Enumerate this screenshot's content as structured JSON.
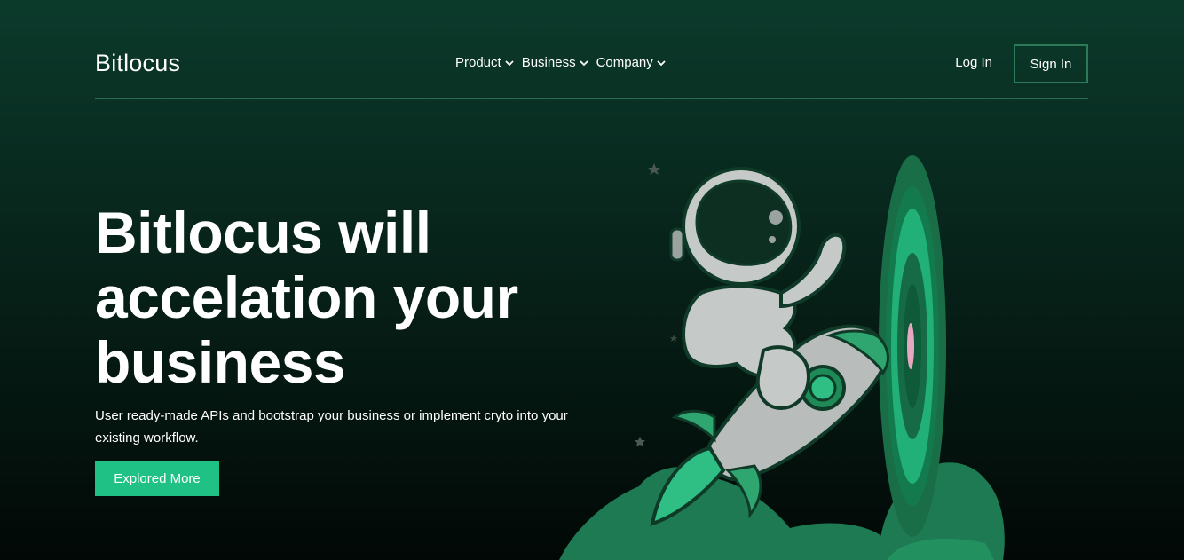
{
  "brand": {
    "name": "Bitlocus"
  },
  "nav": {
    "items": [
      {
        "label": "Product",
        "icon": "chevron-down-icon"
      },
      {
        "label": "Business",
        "icon": "chevron-down-icon"
      },
      {
        "label": "Company",
        "icon": "chevron-down-icon"
      }
    ],
    "login_label": "Log In",
    "signin_label": "Sign In"
  },
  "hero": {
    "title_line1": "Bitlocus will",
    "title_line2": "accelation your",
    "title_line3": "business",
    "subtitle": "User ready-made APIs and bootstrap your business or implement cryto into your existing workflow.",
    "cta_label": "Explored More"
  },
  "colors": {
    "accent": "#20c184",
    "bg_top": "#0b3a2b",
    "bg_bottom": "#020806",
    "signin_border": "#2c7a58"
  },
  "illustration": {
    "icon": "astronaut-rocket-illustration"
  }
}
